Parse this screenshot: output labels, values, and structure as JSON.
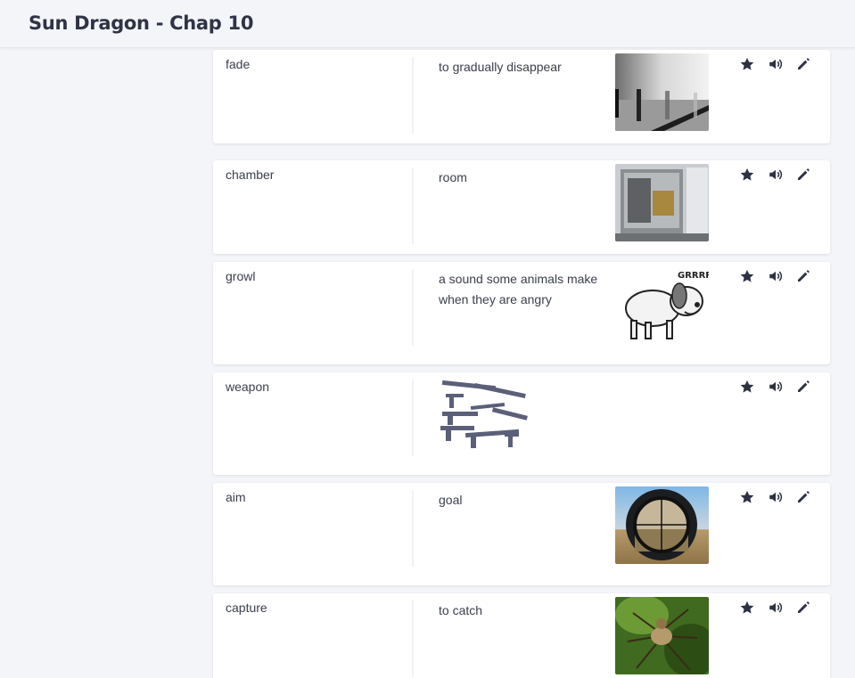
{
  "header": {
    "title": "Sun Dragon - Chap 10"
  },
  "cards": [
    {
      "term": "fade",
      "definition": "to gradually disappear",
      "image": "fading-people-photo"
    },
    {
      "term": "chamber",
      "definition": "room",
      "image": "glass-chamber-photo"
    },
    {
      "term": "growl",
      "definition": "a sound some animals make when they are angry",
      "image": "growling-dog-cartoon"
    },
    {
      "term": "weapon",
      "definition": "",
      "image": "weapons-collection-illustration"
    },
    {
      "term": "aim",
      "definition": "goal",
      "image": "scope-crosshair-photo"
    },
    {
      "term": "capture",
      "definition": "to catch",
      "image": "spider-photo"
    }
  ],
  "image_texts": {
    "growl": "GRRRR!"
  },
  "icons": {
    "star": "star-icon",
    "sound": "speaker-icon",
    "edit": "pencil-icon"
  },
  "colors": {
    "background": "#f4f5f9",
    "card": "#ffffff",
    "text": "#2d3142"
  }
}
